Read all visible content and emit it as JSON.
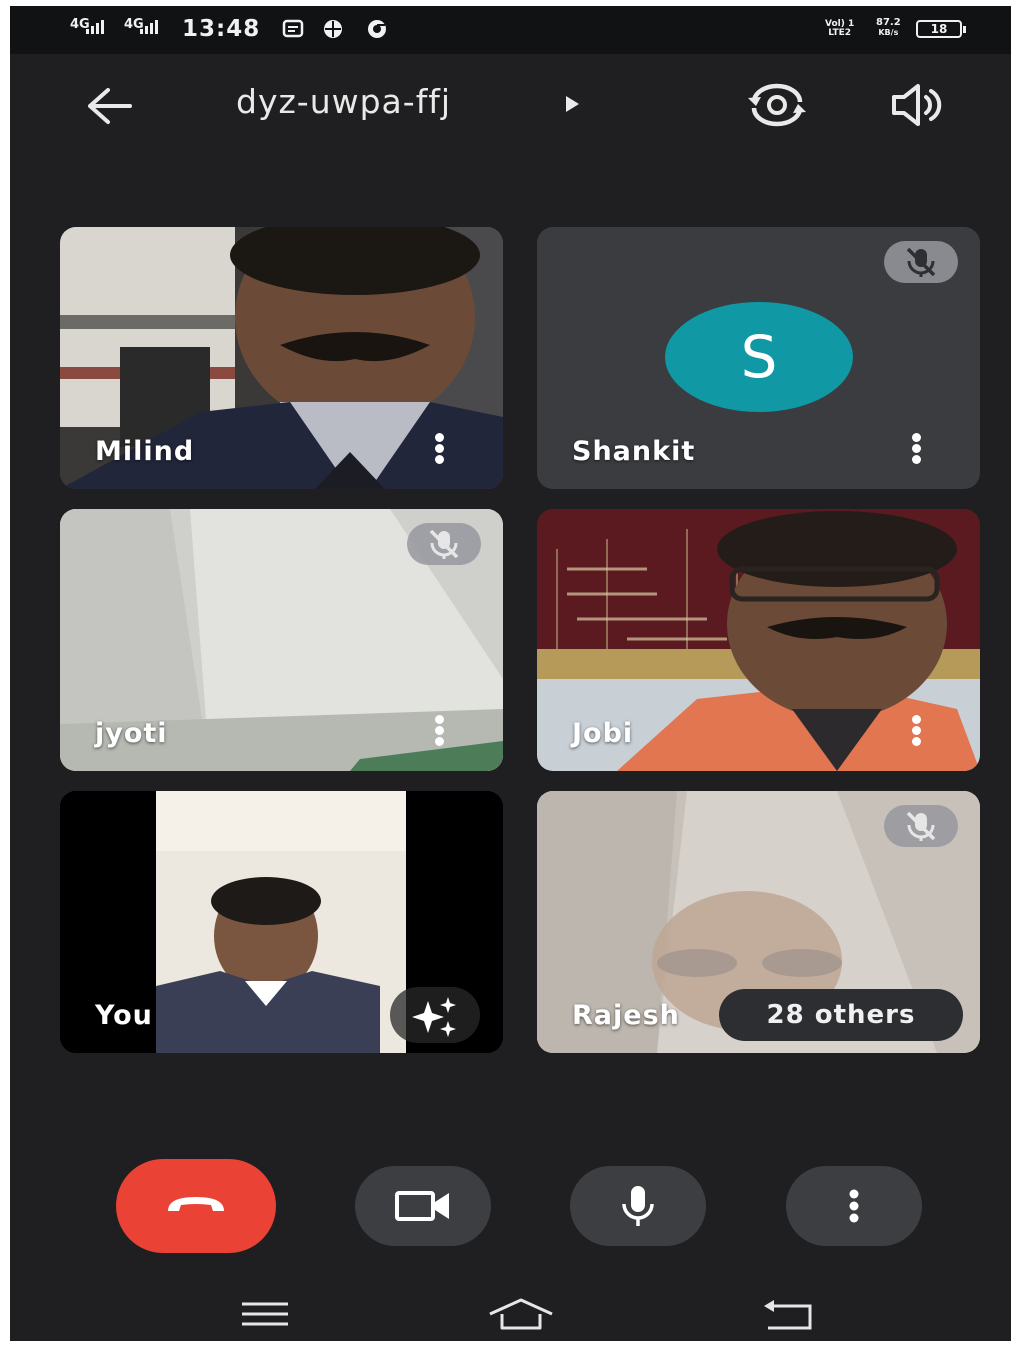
{
  "status_bar": {
    "network_1": "4G",
    "network_2": "4G",
    "time": "13:48",
    "volte_top": "Vol) 1",
    "volte_bottom": "LTE2",
    "speed_value": "87.2",
    "speed_unit": "KB/s",
    "battery": "18",
    "icons": [
      "signal-icon",
      "signal-icon",
      "message-icon",
      "app-icon",
      "chrome-icon"
    ]
  },
  "header": {
    "meeting_code": "dyz-uwpa-ffj",
    "icons": [
      "back-arrow-icon",
      "play-icon",
      "switch-camera-icon",
      "speaker-icon"
    ]
  },
  "participants": [
    {
      "name": "Milind",
      "muted": false,
      "video": true
    },
    {
      "name": "Shankit",
      "muted": true,
      "video": false,
      "avatar_letter": "S"
    },
    {
      "name": "jyoti",
      "muted": true,
      "video": true
    },
    {
      "name": "Jobi",
      "muted": false,
      "video": true
    },
    {
      "name": "You",
      "muted": false,
      "video": true
    },
    {
      "name": "Rajesh",
      "muted": true,
      "video": true
    }
  ],
  "others_chip": "28 others",
  "controls": {
    "end_call_color": "#ea4335",
    "icons": [
      "end-call-icon",
      "video-camera-icon",
      "microphone-icon",
      "more-vert-icon"
    ]
  },
  "navigation_bar": {
    "icons": [
      "menu-icon",
      "home-icon",
      "back-icon"
    ]
  },
  "colors": {
    "background": "#1f1f21",
    "avatar": "#1098a4",
    "control_button": "#3c3e42"
  }
}
